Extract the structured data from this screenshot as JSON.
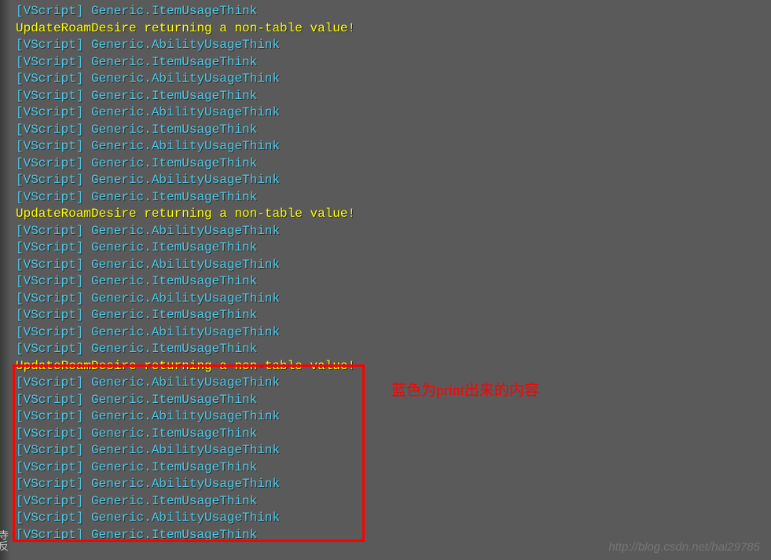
{
  "console": {
    "lines": [
      {
        "cls": "cyan",
        "text": "[VScript] Generic.ItemUsageThink"
      },
      {
        "cls": "yellow",
        "text": "UpdateRoamDesire returning a non-table value!"
      },
      {
        "cls": "cyan",
        "text": "[VScript] Generic.AbilityUsageThink"
      },
      {
        "cls": "cyan",
        "text": "[VScript] Generic.ItemUsageThink"
      },
      {
        "cls": "cyan",
        "text": "[VScript] Generic.AbilityUsageThink"
      },
      {
        "cls": "cyan",
        "text": "[VScript] Generic.ItemUsageThink"
      },
      {
        "cls": "cyan",
        "text": "[VScript] Generic.AbilityUsageThink"
      },
      {
        "cls": "cyan",
        "text": "[VScript] Generic.ItemUsageThink"
      },
      {
        "cls": "cyan",
        "text": "[VScript] Generic.AbilityUsageThink"
      },
      {
        "cls": "cyan",
        "text": "[VScript] Generic.ItemUsageThink"
      },
      {
        "cls": "cyan",
        "text": "[VScript] Generic.AbilityUsageThink"
      },
      {
        "cls": "cyan",
        "text": "[VScript] Generic.ItemUsageThink"
      },
      {
        "cls": "yellow",
        "text": "UpdateRoamDesire returning a non-table value!"
      },
      {
        "cls": "cyan",
        "text": "[VScript] Generic.AbilityUsageThink"
      },
      {
        "cls": "cyan",
        "text": "[VScript] Generic.ItemUsageThink"
      },
      {
        "cls": "cyan",
        "text": "[VScript] Generic.AbilityUsageThink"
      },
      {
        "cls": "cyan",
        "text": "[VScript] Generic.ItemUsageThink"
      },
      {
        "cls": "cyan",
        "text": "[VScript] Generic.AbilityUsageThink"
      },
      {
        "cls": "cyan",
        "text": "[VScript] Generic.ItemUsageThink"
      },
      {
        "cls": "cyan",
        "text": "[VScript] Generic.AbilityUsageThink"
      },
      {
        "cls": "cyan",
        "text": "[VScript] Generic.ItemUsageThink"
      },
      {
        "cls": "yellow",
        "text": "UpdateRoamDesire returning a non-table value!"
      },
      {
        "cls": "cyan",
        "text": "[VScript] Generic.AbilityUsageThink"
      },
      {
        "cls": "cyan",
        "text": "[VScript] Generic.ItemUsageThink"
      },
      {
        "cls": "cyan",
        "text": "[VScript] Generic.AbilityUsageThink"
      },
      {
        "cls": "cyan",
        "text": "[VScript] Generic.ItemUsageThink"
      },
      {
        "cls": "cyan",
        "text": "[VScript] Generic.AbilityUsageThink"
      },
      {
        "cls": "cyan",
        "text": "[VScript] Generic.ItemUsageThink"
      },
      {
        "cls": "cyan",
        "text": "[VScript] Generic.AbilityUsageThink"
      },
      {
        "cls": "cyan",
        "text": "[VScript] Generic.ItemUsageThink"
      },
      {
        "cls": "cyan",
        "text": "[VScript] Generic.AbilityUsageThink"
      },
      {
        "cls": "cyan",
        "text": "[VScript] Generic.ItemUsageThink"
      }
    ]
  },
  "annotation": "蓝色为print出来的内容",
  "watermark": "http://blog.csdn.net/hai29785",
  "left_label": "寺反"
}
